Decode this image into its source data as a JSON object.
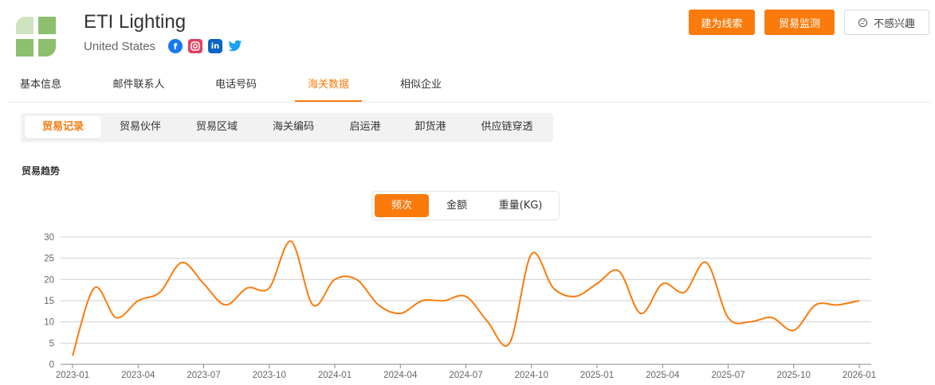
{
  "company": {
    "name": "ETI Lighting",
    "country": "United States",
    "social_icons": [
      "facebook-icon",
      "instagram-icon",
      "linkedin-icon",
      "twitter-icon"
    ]
  },
  "actions": {
    "lead_label": "建为线索",
    "monitor_label": "贸易监测",
    "not_interested_label": "不感兴趣"
  },
  "main_tabs": [
    "基本信息",
    "邮件联系人",
    "电话号码",
    "海关数据",
    "相似企业"
  ],
  "main_tab_active": "海关数据",
  "sub_tabs": [
    "贸易记录",
    "贸易伙伴",
    "贸易区域",
    "海关编码",
    "启运港",
    "卸货港",
    "供应链穿透"
  ],
  "sub_tab_active": "贸易记录",
  "section_title": "贸易趋势",
  "metric_tabs": [
    "频次",
    "金额",
    "重量(KG)"
  ],
  "metric_active": "频次",
  "colors": {
    "accent": "#fa7b0c",
    "logo_green": "#8dbf6e",
    "logo_light_green": "#cfe3c1",
    "facebook": "#1877f2",
    "instagram": "#e4405f",
    "linkedin": "#0a66c2",
    "twitter": "#1da1f2"
  },
  "chart_data": {
    "type": "line",
    "x_ticks": [
      "2023-01",
      "2023-04",
      "2023-07",
      "2023-10",
      "2024-01",
      "2024-04",
      "2024-07",
      "2024-10",
      "2025-01",
      "2025-04",
      "2025-07",
      "2025-10",
      "2026-01"
    ],
    "y_ticks": [
      0,
      5,
      10,
      15,
      20,
      25,
      30
    ],
    "ylim": [
      0,
      30
    ],
    "smooth": true,
    "grid": "horizontal",
    "series": [
      {
        "x": [
          "2023-01",
          "2023-02",
          "2023-03",
          "2023-04",
          "2023-05",
          "2023-06",
          "2023-07",
          "2023-08",
          "2023-09",
          "2023-10",
          "2023-11",
          "2023-12",
          "2024-01",
          "2024-02",
          "2024-03",
          "2024-04",
          "2024-05",
          "2024-06",
          "2024-07",
          "2024-08",
          "2024-09",
          "2024-10",
          "2024-11",
          "2024-12",
          "2025-01",
          "2025-02",
          "2025-03",
          "2025-04",
          "2025-05",
          "2025-06",
          "2025-07",
          "2025-08",
          "2025-09",
          "2025-10",
          "2025-11",
          "2025-12",
          "2026-01"
        ],
        "values": [
          2,
          18,
          11,
          15,
          17,
          24,
          19,
          14,
          18,
          18,
          29,
          14,
          20,
          20,
          14,
          12,
          15,
          15,
          16,
          10,
          5,
          26,
          18,
          16,
          19,
          22,
          12,
          19,
          17,
          24,
          11,
          10,
          11,
          8,
          14,
          14,
          15
        ]
      }
    ]
  }
}
